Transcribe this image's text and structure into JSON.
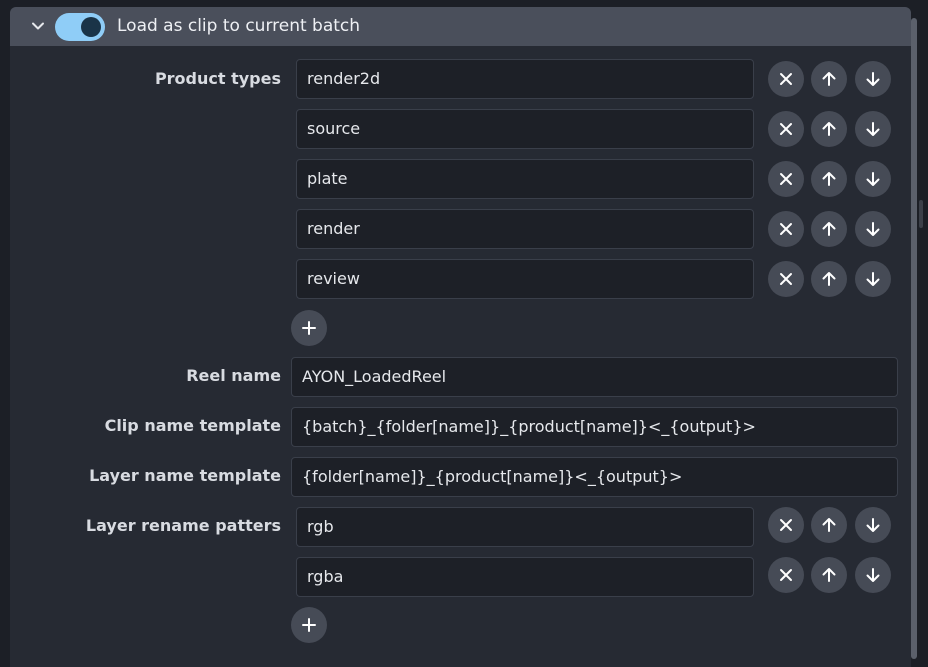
{
  "section": {
    "title": "Load as clip to current batch",
    "enabled": true,
    "icons": {
      "collapse": "chevron-down-icon"
    }
  },
  "product_types": {
    "label": "Product types",
    "items": [
      "render2d",
      "source",
      "plate",
      "render",
      "review"
    ]
  },
  "reel_name": {
    "label": "Reel name",
    "value": "AYON_LoadedReel"
  },
  "clip_name_template": {
    "label": "Clip name template",
    "value": "{batch}_{folder[name]}_{product[name]}<_{output}>"
  },
  "layer_name_template": {
    "label": "Layer name template",
    "value": "{folder[name]}_{product[name]}<_{output}>"
  },
  "layer_rename_patterns": {
    "label": "Layer rename patters",
    "items": [
      "rgb",
      "rgba"
    ]
  },
  "icons": {
    "remove": "close-icon",
    "up": "arrow-up-icon",
    "down": "arrow-down-icon",
    "add": "plus-icon"
  },
  "colors": {
    "accent": "#8fcdf7",
    "background": "#1c1f26",
    "panel": "#262a33",
    "header": "#4a4f5b",
    "button": "#464b56",
    "field": "#1d2027"
  }
}
